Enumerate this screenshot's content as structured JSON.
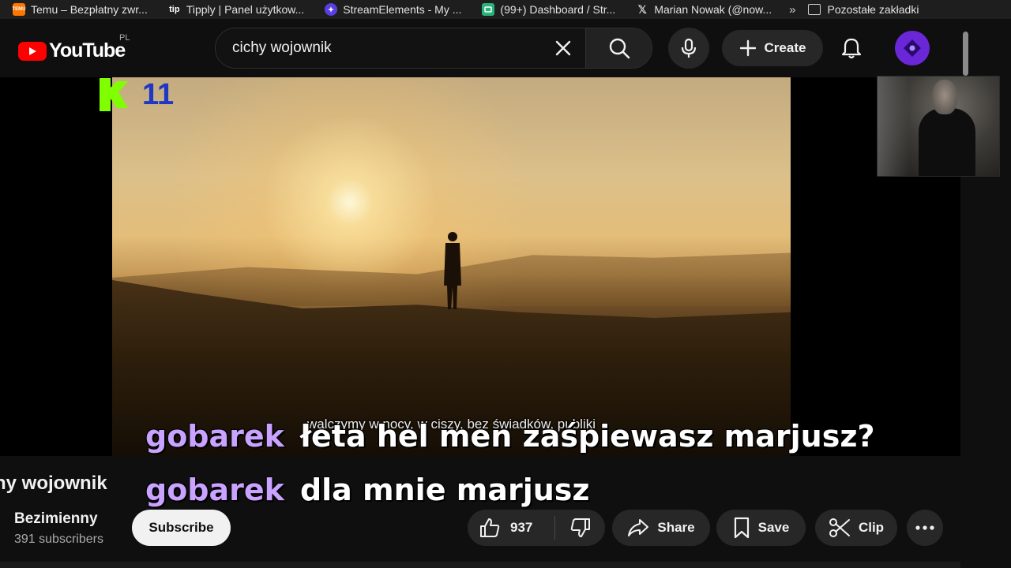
{
  "bookmarks": {
    "items": [
      {
        "label": "Temu – Bezpłatny zwr...",
        "icon": "temu-icon",
        "color": "#fb7701",
        "glyph": "TEMU"
      },
      {
        "label": "Tipply | Panel użytkow...",
        "icon": "tipply-icon",
        "color": "#1e1e1e",
        "glyph": "tip"
      },
      {
        "label": "StreamElements - My ...",
        "icon": "streamelements-icon",
        "color": "#5a3fe0",
        "glyph": ""
      },
      {
        "label": "(99+) Dashboard / Str...",
        "icon": "dashboard-icon",
        "color": "#2ab27b",
        "glyph": ""
      },
      {
        "label": "Marian Nowak (@now...",
        "icon": "x-icon",
        "color": "#1e1e1e",
        "glyph": "X"
      }
    ],
    "other_label": "Pozostałe zakładki"
  },
  "header": {
    "logo_text": "YouTube",
    "region": "PL",
    "search_value": "cichy wojownik",
    "create_label": "Create"
  },
  "player": {
    "caption": "walczymy w nocy, w ciszy, bez świadków, publiki",
    "overlay_number": "11",
    "chat": [
      {
        "user": "gobarek",
        "message": "łeta hel men zaśpiewasz marjusz?"
      },
      {
        "user": "gobarek",
        "message": "dla mnie marjusz"
      }
    ]
  },
  "video": {
    "title": "hy wojownik",
    "channel": "Bezimienny",
    "subscribers": "391 subscribers",
    "subscribe_label": "Subscribe",
    "likes": "937",
    "share_label": "Share",
    "save_label": "Save",
    "clip_label": "Clip"
  },
  "colors": {
    "accent": "#ff0000",
    "chat_user": "#c9a3ff",
    "k_logo": "#7fff00",
    "k_number": "#1f37c4",
    "avatar": "#6a27d8"
  }
}
